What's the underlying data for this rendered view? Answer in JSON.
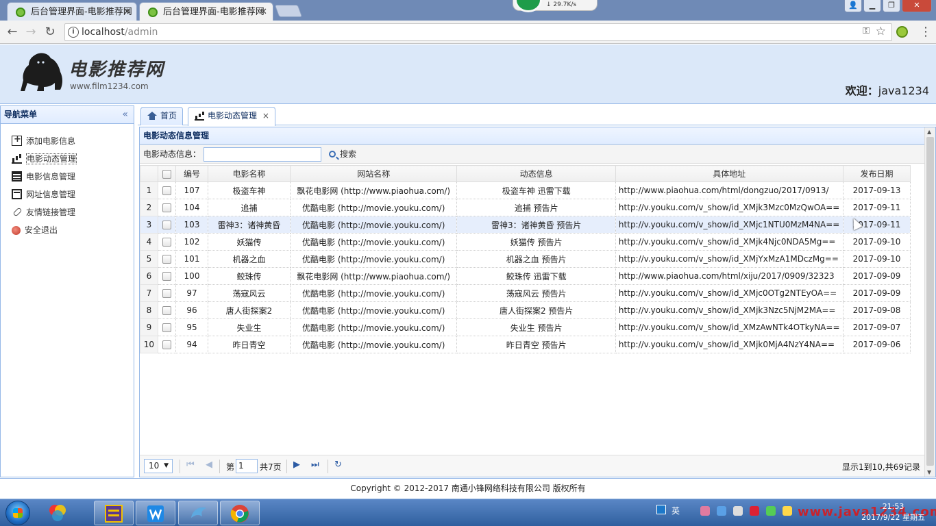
{
  "browser": {
    "tabs": [
      {
        "title": "后台管理界面-电影推荐网"
      },
      {
        "title": "后台管理界面-电影推荐网"
      }
    ],
    "net_speed": "↓ 29.7K/s",
    "url_host": "localhost",
    "url_path": "/admin"
  },
  "header": {
    "logo_title": "电影推荐网",
    "logo_sub": "www.film1234.com",
    "welcome_label": "欢迎：",
    "username": "java1234"
  },
  "sidebar": {
    "title": "导航菜单",
    "collapse_icon": "«",
    "items": [
      {
        "label": "添加电影信息",
        "icon": "add-icon"
      },
      {
        "label": "电影动态管理",
        "icon": "chart-icon"
      },
      {
        "label": "电影信息管理",
        "icon": "film-icon"
      },
      {
        "label": "网址信息管理",
        "icon": "web-icon"
      },
      {
        "label": "友情链接管理",
        "icon": "link-icon"
      },
      {
        "label": "安全退出",
        "icon": "exit-icon"
      }
    ]
  },
  "main": {
    "tabs": [
      {
        "label": "首页",
        "icon": "home-icon"
      },
      {
        "label": "电影动态管理",
        "icon": "chart-icon",
        "close": "×"
      }
    ],
    "panel_title": "电影动态信息管理",
    "search_label": "电影动态信息：",
    "search_value": "",
    "search_button": "搜索",
    "columns": [
      "编号",
      "电影名称",
      "网站名称",
      "动态信息",
      "具体地址",
      "发布日期"
    ],
    "rows": [
      {
        "rn": "1",
        "id": "107",
        "movie": "极盗车神",
        "site": "飘花电影网 (http://www.piaohua.com/)",
        "info": "极盗车神 迅雷下载",
        "url": "http://www.piaohua.com/html/dongzuo/2017/0913/",
        "date": "2017-09-13"
      },
      {
        "rn": "2",
        "id": "104",
        "movie": "追捕",
        "site": "优酷电影 (http://movie.youku.com/)",
        "info": "追捕 预告片",
        "url": "http://v.youku.com/v_show/id_XMjk3Mzc0MzQwOA==",
        "date": "2017-09-11"
      },
      {
        "rn": "3",
        "id": "103",
        "movie": "雷神3：诸神黄昏",
        "site": "优酷电影 (http://movie.youku.com/)",
        "info": "雷神3：诸神黄昏 预告片",
        "url": "http://v.youku.com/v_show/id_XMjc1NTU0MzM4NA==",
        "date": "2017-09-11"
      },
      {
        "rn": "4",
        "id": "102",
        "movie": "妖猫传",
        "site": "优酷电影 (http://movie.youku.com/)",
        "info": "妖猫传 预告片",
        "url": "http://v.youku.com/v_show/id_XMjk4Njc0NDA5Mg==",
        "date": "2017-09-10"
      },
      {
        "rn": "5",
        "id": "101",
        "movie": "机器之血",
        "site": "优酷电影 (http://movie.youku.com/)",
        "info": "机器之血 预告片",
        "url": "http://v.youku.com/v_show/id_XMjYxMzA1MDczMg==",
        "date": "2017-09-10"
      },
      {
        "rn": "6",
        "id": "100",
        "movie": "鲛珠传",
        "site": "飘花电影网 (http://www.piaohua.com/)",
        "info": "鲛珠传 迅雷下载",
        "url": "http://www.piaohua.com/html/xiju/2017/0909/32323",
        "date": "2017-09-09"
      },
      {
        "rn": "7",
        "id": "97",
        "movie": "荡寇风云",
        "site": "优酷电影 (http://movie.youku.com/)",
        "info": "荡寇风云 预告片",
        "url": "http://v.youku.com/v_show/id_XMjc0OTg2NTEyOA==",
        "date": "2017-09-09"
      },
      {
        "rn": "8",
        "id": "96",
        "movie": "唐人街探案2",
        "site": "优酷电影 (http://movie.youku.com/)",
        "info": "唐人街探案2 预告片",
        "url": "http://v.youku.com/v_show/id_XMjk3Nzc5NjM2MA==",
        "date": "2017-09-08"
      },
      {
        "rn": "9",
        "id": "95",
        "movie": "失业生",
        "site": "优酷电影 (http://movie.youku.com/)",
        "info": "失业生 预告片",
        "url": "http://v.youku.com/v_show/id_XMzAwNTk4OTkyNA==",
        "date": "2017-09-07"
      },
      {
        "rn": "10",
        "id": "94",
        "movie": "昨日青空",
        "site": "优酷电影 (http://movie.youku.com/)",
        "info": "昨日青空 预告片",
        "url": "http://v.youku.com/v_show/id_XMjk0MjA4NzY4NA==",
        "date": "2017-09-06"
      }
    ],
    "pager": {
      "page_size": "10",
      "page_label": "第",
      "page_value": "1",
      "total_pages": "共7页",
      "info": "显示1到10,共69记录"
    }
  },
  "footer": {
    "copyright": "Copyright © 2012-2017 南通小锋网络科技有限公司 版权所有"
  },
  "taskbar": {
    "ime_lang": "英",
    "time": "21:53",
    "date": "2017/9/22 星期五",
    "watermark": "www.java1234.com"
  },
  "colors": {
    "accent_border": "#95b8e7",
    "header_bg": "#dbe8f9",
    "taskbar": "#2f5f9f"
  }
}
